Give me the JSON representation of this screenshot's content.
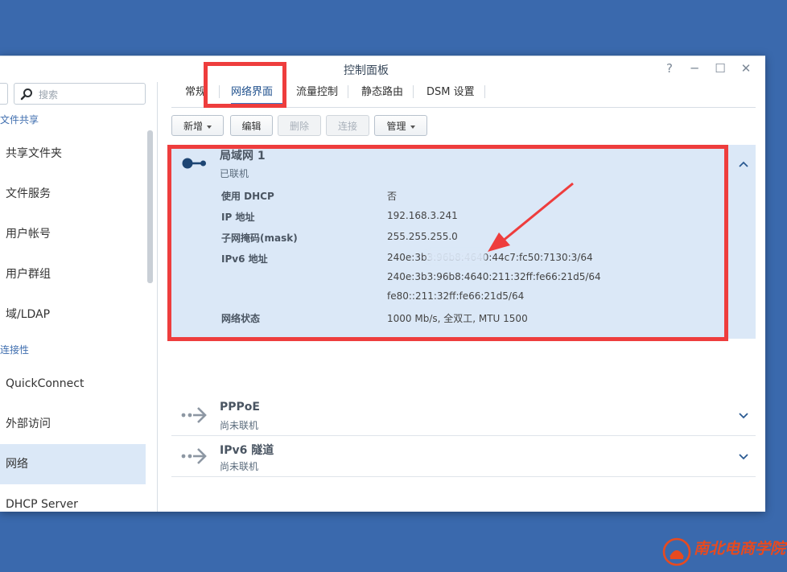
{
  "window": {
    "title": "控制面板",
    "controls": {
      "help": "?",
      "minimize": "─",
      "maximize": "☐",
      "close": "✕"
    }
  },
  "sidebar": {
    "search_placeholder": "搜索",
    "groups": [
      {
        "title": "文件共享",
        "items": [
          "共享文件夹",
          "文件服务",
          "用户帐号",
          "用户群组",
          "域/LDAP"
        ]
      },
      {
        "title": "连接性",
        "items": [
          "QuickConnect",
          "外部访问",
          "网络",
          "DHCP Server"
        ]
      }
    ],
    "active_item": "网络"
  },
  "tabs": [
    {
      "label": "常规"
    },
    {
      "label": "网络界面",
      "active": true
    },
    {
      "label": "流量控制"
    },
    {
      "label": "静态路由"
    },
    {
      "label": "DSM 设置"
    }
  ],
  "toolbar": {
    "new": "新增",
    "edit": "编辑",
    "delete": "删除",
    "connect": "连接",
    "manage": "管理"
  },
  "interfaces": [
    {
      "name": "局域网 1",
      "status": "已联机",
      "expanded": true,
      "details": [
        {
          "label": "使用 DHCP",
          "value": "否"
        },
        {
          "label": "IP 地址",
          "value": "192.168.3.241"
        },
        {
          "label": "子网掩码(mask)",
          "value": "255.255.255.0"
        },
        {
          "label": "IPv6 地址",
          "values": [
            "240e:3b3:96b8:4640:44c7:fc50:7130:3/64",
            "240e:3b3:96b8:4640:211:32ff:fe66:21d5/64",
            "fe80::211:32ff:fe66:21d5/64"
          ]
        },
        {
          "label": "网络状态",
          "value": "1000 Mb/s, 全双工, MTU 1500"
        }
      ]
    },
    {
      "name": "PPPoE",
      "status": "尚未联机",
      "expanded": false
    },
    {
      "name": "IPv6 隧道",
      "status": "尚未联机",
      "expanded": false
    }
  ],
  "colors": {
    "desktop": "#3a69ad",
    "accent": "#3a78c7",
    "selected": "#dbe8f7",
    "annotation": "#ee3d3d"
  },
  "watermark": {
    "text": "南北电商学院"
  }
}
